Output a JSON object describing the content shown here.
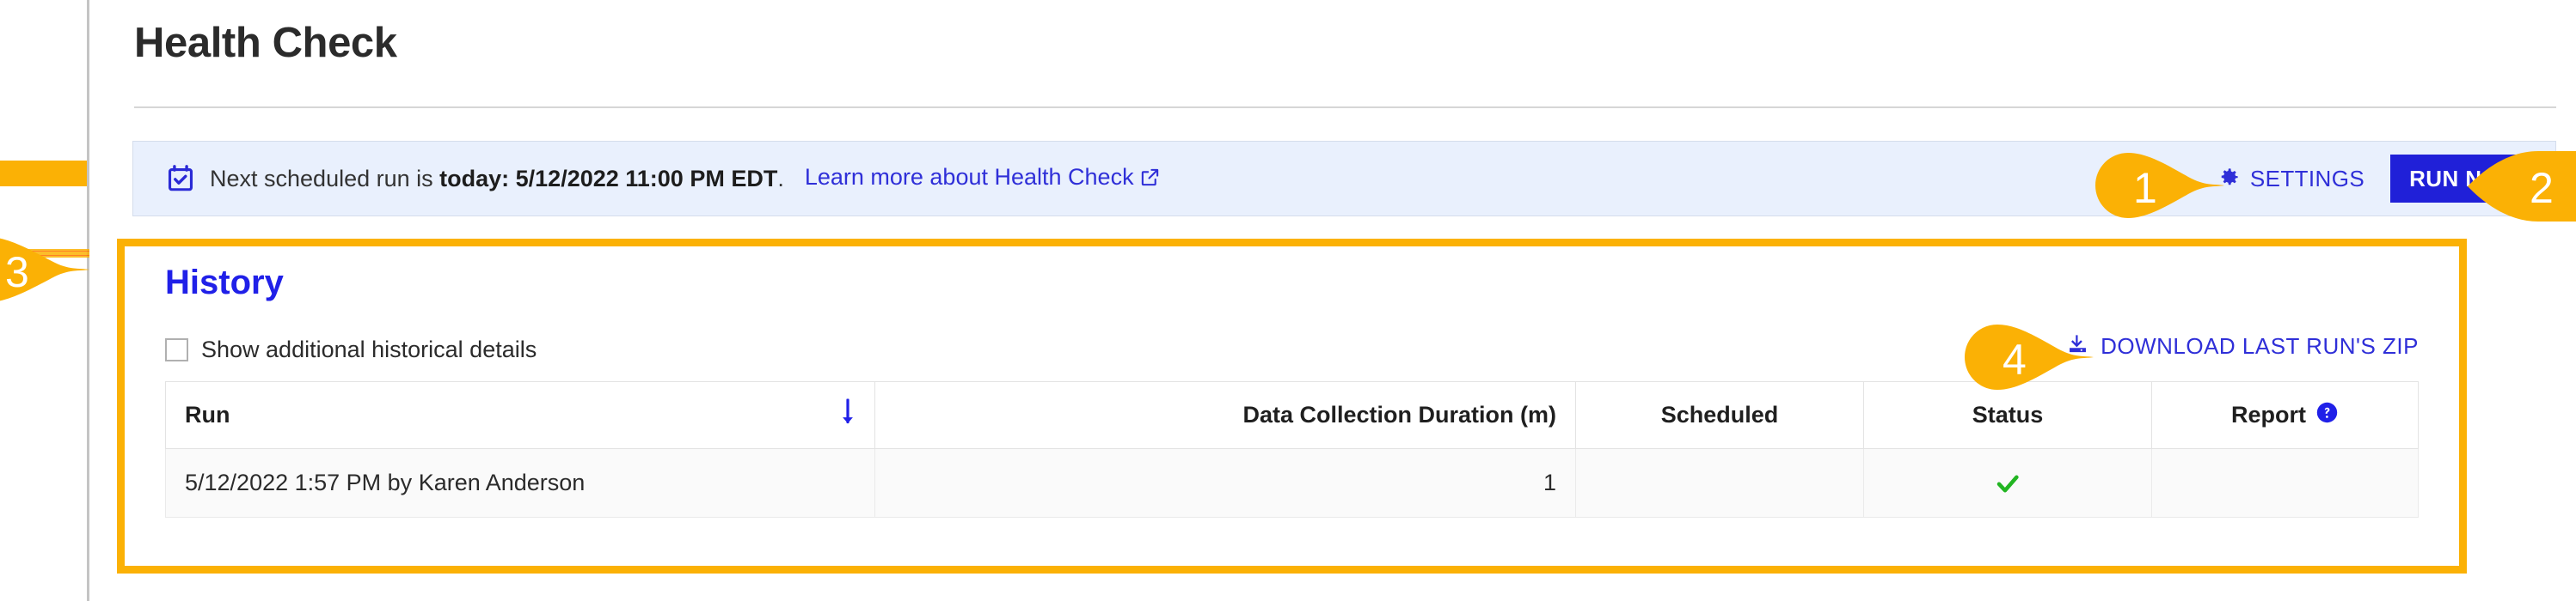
{
  "page": {
    "title": "Health Check"
  },
  "notice": {
    "icon": "calendar-check-icon",
    "text_prefix": "Next scheduled run is ",
    "text_bold": "today: 5/12/2022 11:00 PM EDT",
    "text_suffix": ".",
    "link_label": "Learn more about Health Check",
    "link_icon": "external-link-icon",
    "settings_label": "SETTINGS",
    "settings_icon": "gear-icon",
    "run_now_label": "RUN NOW",
    "background_color": "#e9f0fd",
    "accent_color": "#2020d8"
  },
  "history": {
    "heading": "History",
    "show_details_label": "Show additional historical details",
    "show_details_checked": false,
    "download_label": "DOWNLOAD LAST RUN'S ZIP",
    "download_icon": "download-icon",
    "highlight_color": "#FBB105"
  },
  "table": {
    "columns": [
      {
        "key": "run",
        "label": "Run",
        "align": "left",
        "sort_icon": "sort-descending-arrow-icon"
      },
      {
        "key": "duration",
        "label": "Data Collection Duration (m)",
        "align": "right"
      },
      {
        "key": "scheduled",
        "label": "Scheduled",
        "align": "center"
      },
      {
        "key": "status",
        "label": "Status",
        "align": "center"
      },
      {
        "key": "report",
        "label": "Report",
        "align": "center",
        "help_icon": "help-circle-icon"
      }
    ],
    "rows": [
      {
        "run": "5/12/2022 1:57 PM by Karen Anderson",
        "duration": "1",
        "scheduled": "",
        "status_icon": "green-check-icon",
        "report": ""
      }
    ]
  },
  "callouts": [
    {
      "number": "1",
      "direction": "right",
      "target": "settings-button"
    },
    {
      "number": "2",
      "direction": "left",
      "target": "run-now-button"
    },
    {
      "number": "3",
      "direction": "right",
      "target": "history-section"
    },
    {
      "number": "4",
      "direction": "right",
      "target": "download-link"
    }
  ],
  "colors": {
    "brand_blue": "#2020d8",
    "link_blue": "#2f2fd8",
    "highlight_orange": "#FBB105",
    "success_green": "#22b522"
  }
}
